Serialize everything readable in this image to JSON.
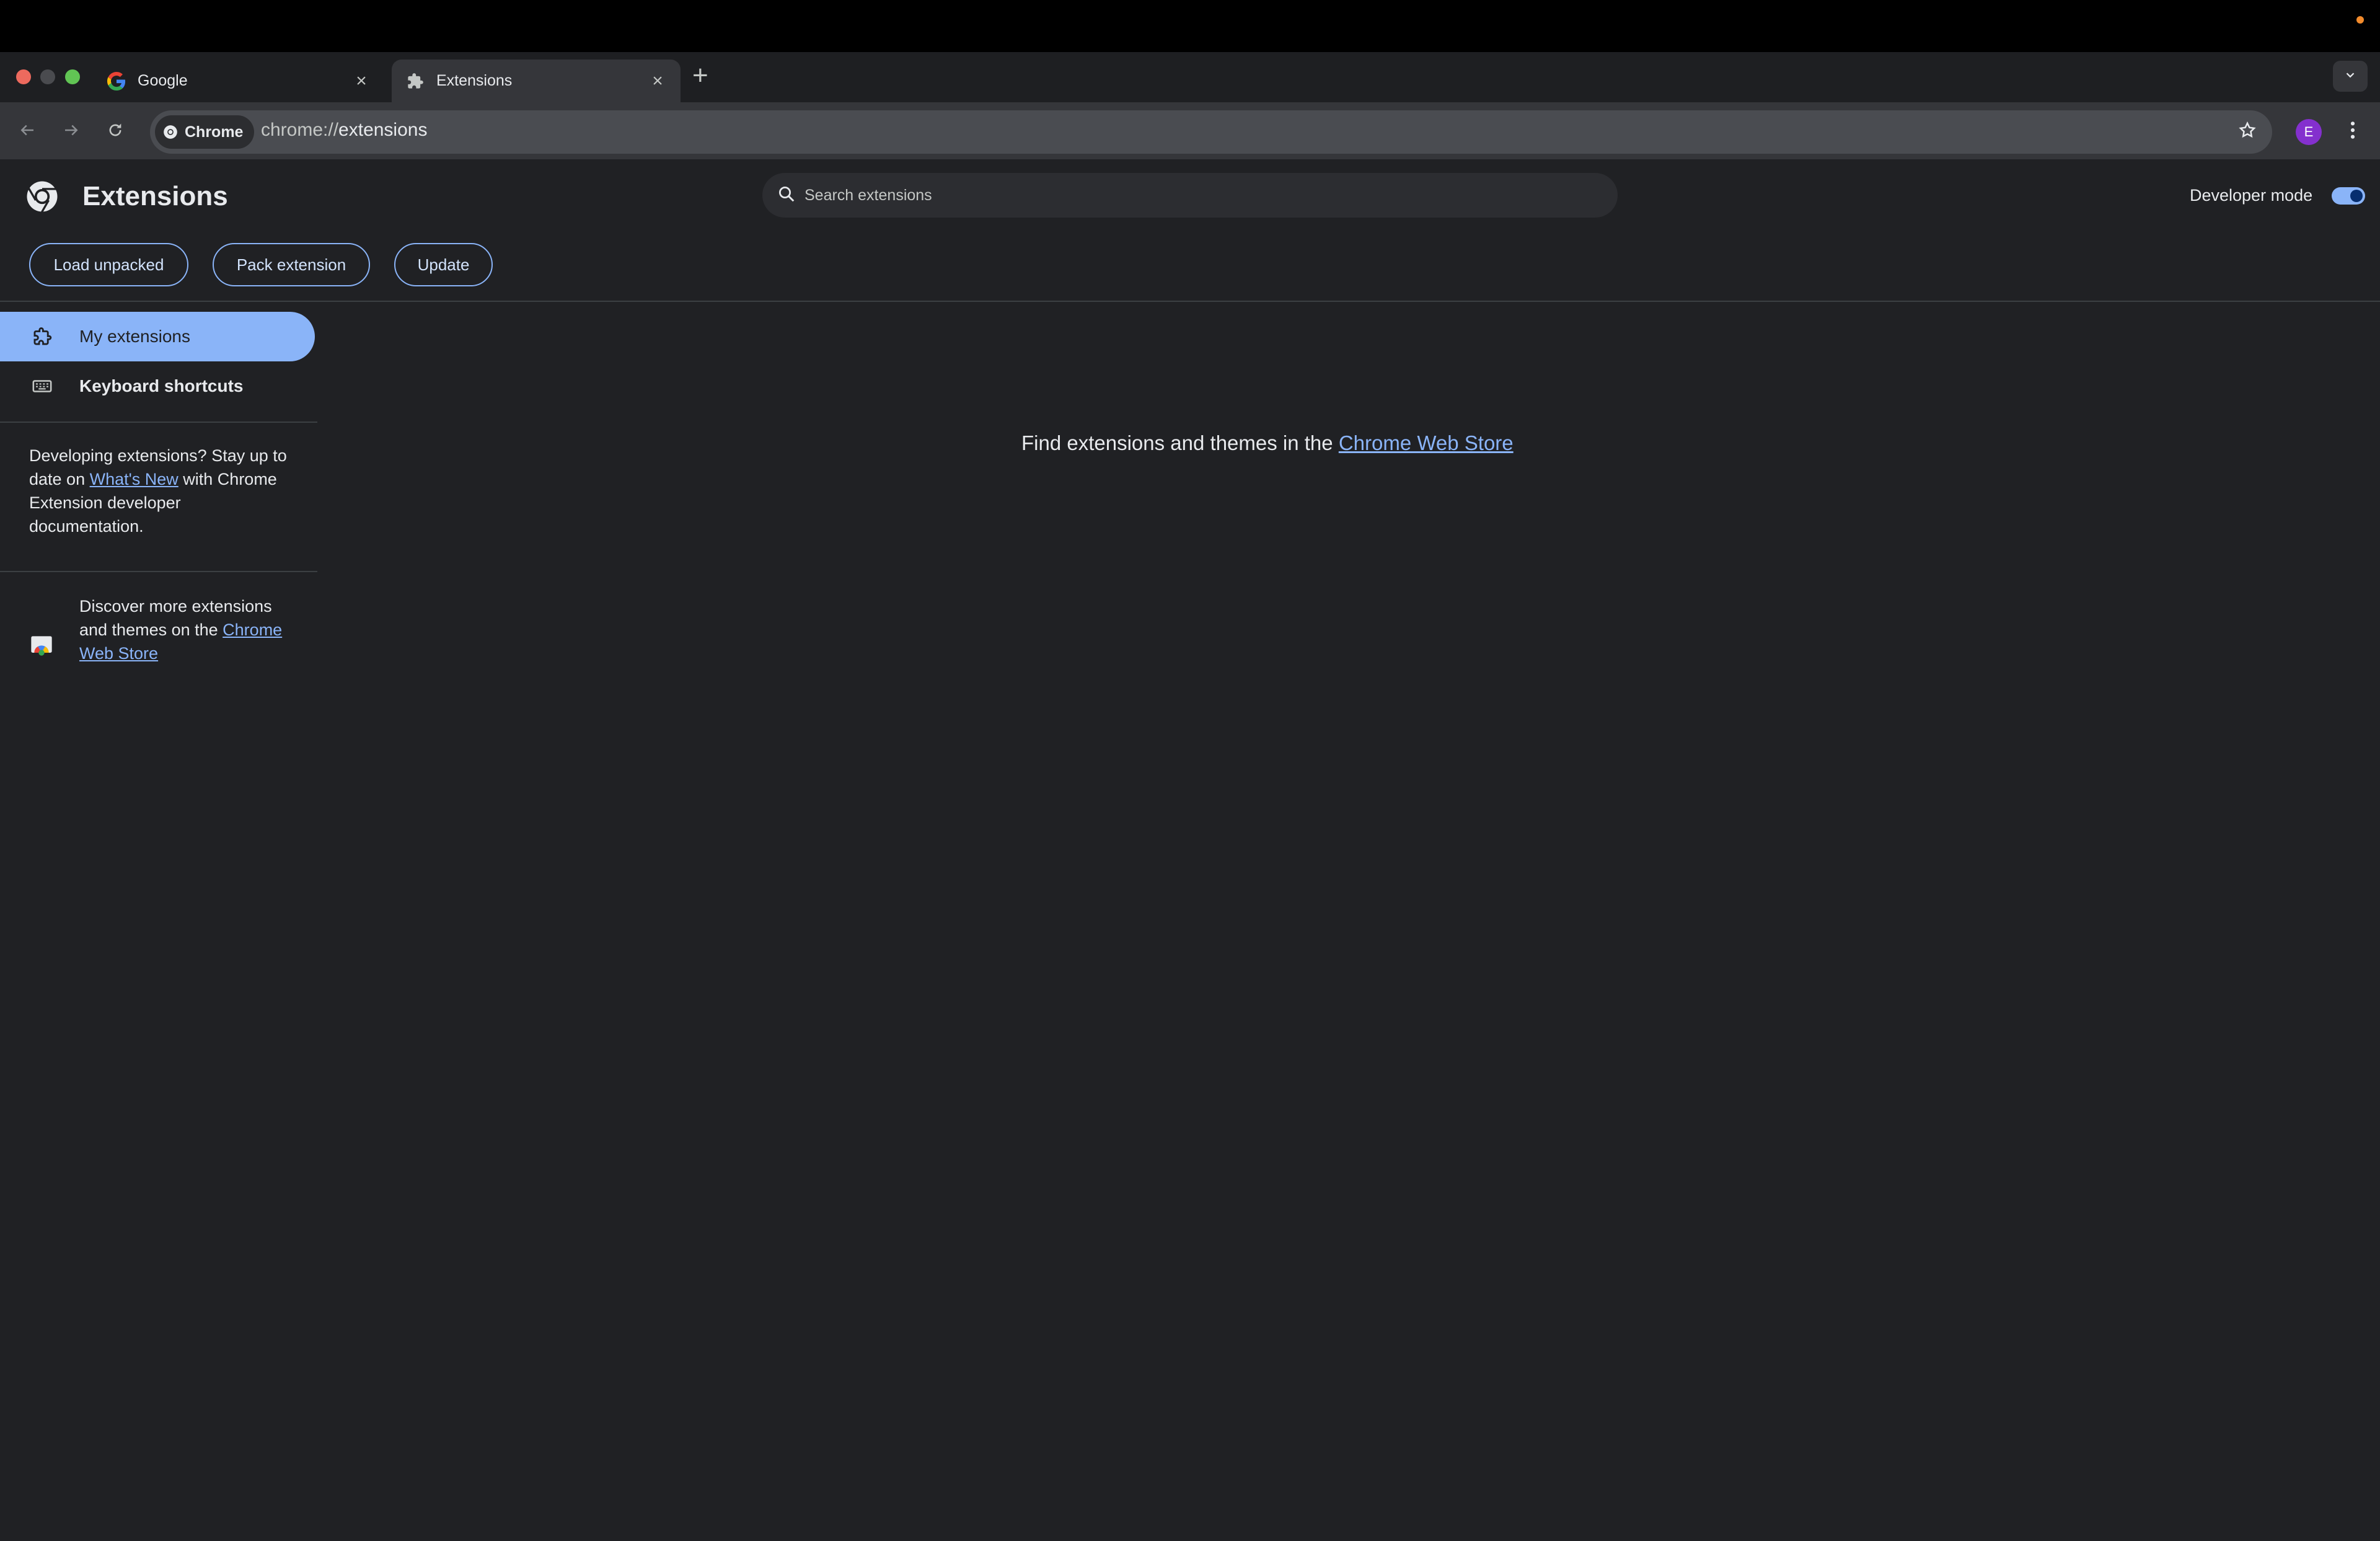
{
  "browser": {
    "tabs": [
      {
        "label": "Google",
        "icon": "google-g-icon"
      },
      {
        "label": "Extensions",
        "icon": "puzzle-piece-icon",
        "active": true
      }
    ],
    "new_tab_label": "+",
    "omnibox": {
      "chip_label": "Chrome",
      "url_scheme": "chrome://",
      "url_path": "extensions"
    },
    "profile_initial": "E"
  },
  "header": {
    "title": "Extensions",
    "search_placeholder": "Search extensions",
    "developer_mode_label": "Developer mode",
    "developer_mode_on": true
  },
  "actions": {
    "load_unpacked": "Load unpacked",
    "pack_extension": "Pack extension",
    "update": "Update"
  },
  "sidebar": {
    "items": [
      {
        "label": "My extensions",
        "icon": "puzzle-outline-icon",
        "selected": true
      },
      {
        "label": "Keyboard shortcuts",
        "icon": "keyboard-icon",
        "selected": false
      }
    ],
    "dev_text_before": "Developing extensions? Stay up to date on ",
    "dev_link": "What's New",
    "dev_text_after": " with Chrome Extension developer documentation.",
    "discover_text": "Discover more extensions and themes on the ",
    "discover_link": "Chrome Web Store"
  },
  "main": {
    "message": "Find extensions and themes in the ",
    "message_link": "Chrome Web Store"
  },
  "colors": {
    "background": "#202124",
    "accent": "#8ab4f8",
    "toolbar": "#35363a"
  }
}
